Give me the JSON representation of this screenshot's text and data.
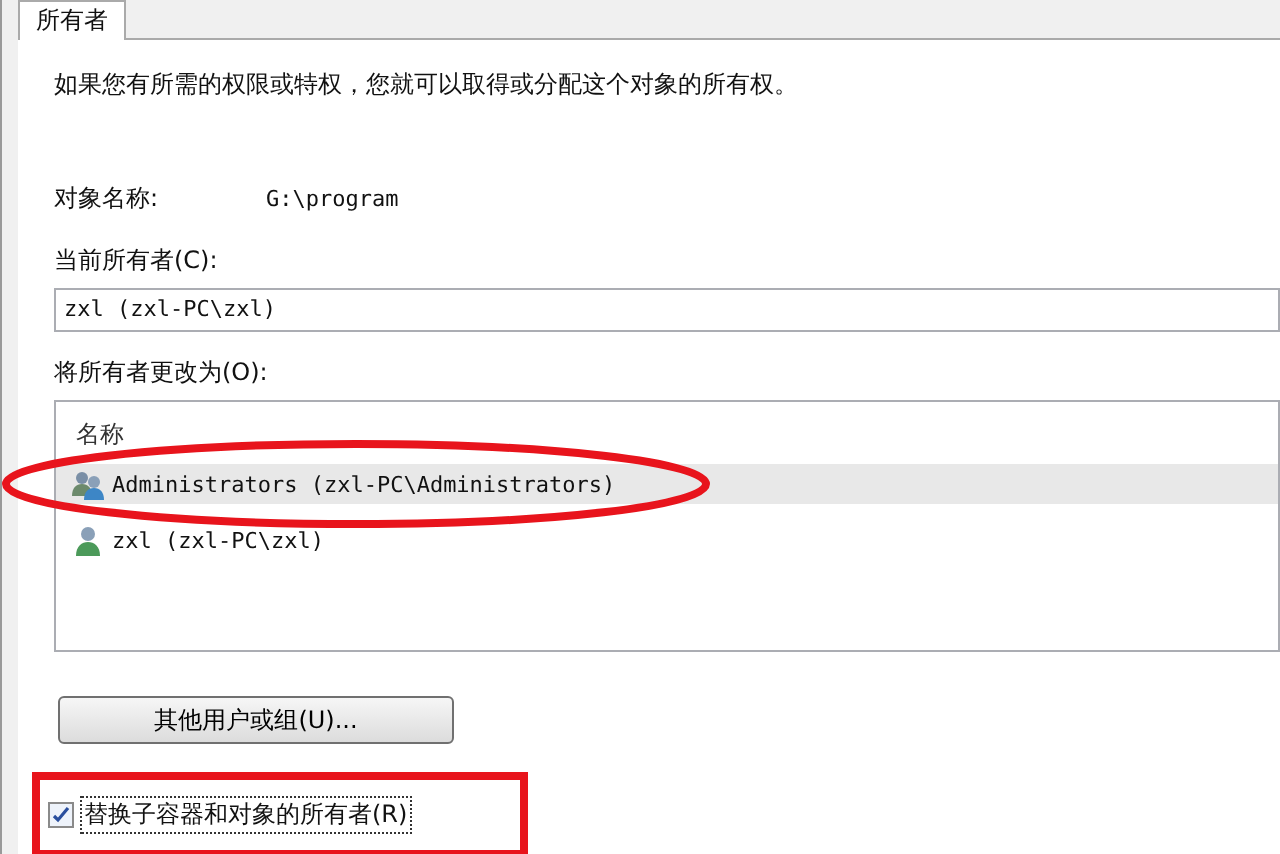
{
  "tabs": [
    {
      "label": "所有者",
      "selected": true
    }
  ],
  "description": "如果您有所需的权限或特权，您就可以取得或分配这个对象的所有权。",
  "object_name": {
    "label": "对象名称:",
    "value": "G:\\program"
  },
  "current_owner": {
    "label": "当前所有者(C):",
    "value": "zxl (zxl-PC\\zxl)"
  },
  "change_owner": {
    "label": "将所有者更改为(O):",
    "column": "名称",
    "rows": [
      {
        "name": "Administrators (zxl-PC\\Administrators)",
        "kind": "group",
        "selected": true
      },
      {
        "name": "zxl (zxl-PC\\zxl)",
        "kind": "user",
        "selected": false
      }
    ]
  },
  "other_users_button": "其他用户或组(U)...",
  "replace_owner": {
    "label": "替换子容器和对象的所有者(R)",
    "checked": true
  }
}
